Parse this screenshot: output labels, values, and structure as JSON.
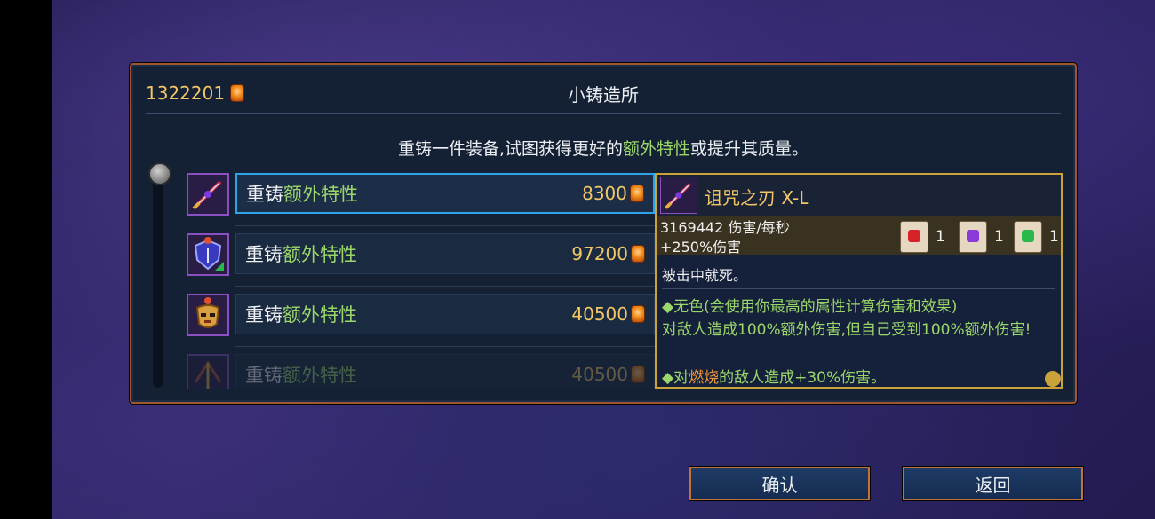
{
  "currency": {
    "amount": "1322201"
  },
  "title": "小铸造所",
  "description": {
    "before": "重铸一件装备,试图获得更好的",
    "highlight": "额外特性",
    "after": "或提升其质量。"
  },
  "rows": [
    {
      "label_prefix": "重铸",
      "label_highlight": "额外特性",
      "cost": "8300",
      "selected": true,
      "icon": "cursed-sword-icon"
    },
    {
      "label_prefix": "重铸",
      "label_highlight": "额外特性",
      "cost": "97200",
      "selected": false,
      "icon": "shield-icon"
    },
    {
      "label_prefix": "重铸",
      "label_highlight": "额外特性",
      "cost": "40500",
      "selected": false,
      "icon": "mask-icon"
    },
    {
      "label_prefix": "重铸",
      "label_highlight": "额外特性",
      "cost": "40500",
      "selected": false,
      "icon": "crossbow-icon"
    }
  ],
  "tooltip": {
    "name": "诅咒之刃  X-L",
    "dps": "3169442 伤害/每秒",
    "bonus": "+250%伤害",
    "scrolls": [
      {
        "icon": "brutality-scroll-icon",
        "count": "1",
        "color": "#d8222a"
      },
      {
        "icon": "tactics-scroll-icon",
        "count": "1",
        "color": "#8a3ad8"
      },
      {
        "icon": "survival-scroll-icon",
        "count": "1",
        "color": "#2ab84a"
      }
    ],
    "effect": "被击中就死。",
    "lines": [
      {
        "bullet": "◆",
        "text": "无色(会使用你最高的属性计算伤害和效果)"
      },
      {
        "bullet": "",
        "text": "对敌人造成100%额外伤害,但自己受到100%额外伤害!"
      },
      {
        "bullet": "◆",
        "pre": "对",
        "hl": "燃烧",
        "post": "的敌人造成+30%伤害。"
      }
    ]
  },
  "buttons": {
    "confirm": "确认",
    "back": "返回"
  },
  "colors": {
    "gold": "#f3c766",
    "green": "#9bd66a",
    "orange": "#f09a3a",
    "selection": "#2ea3e8"
  }
}
